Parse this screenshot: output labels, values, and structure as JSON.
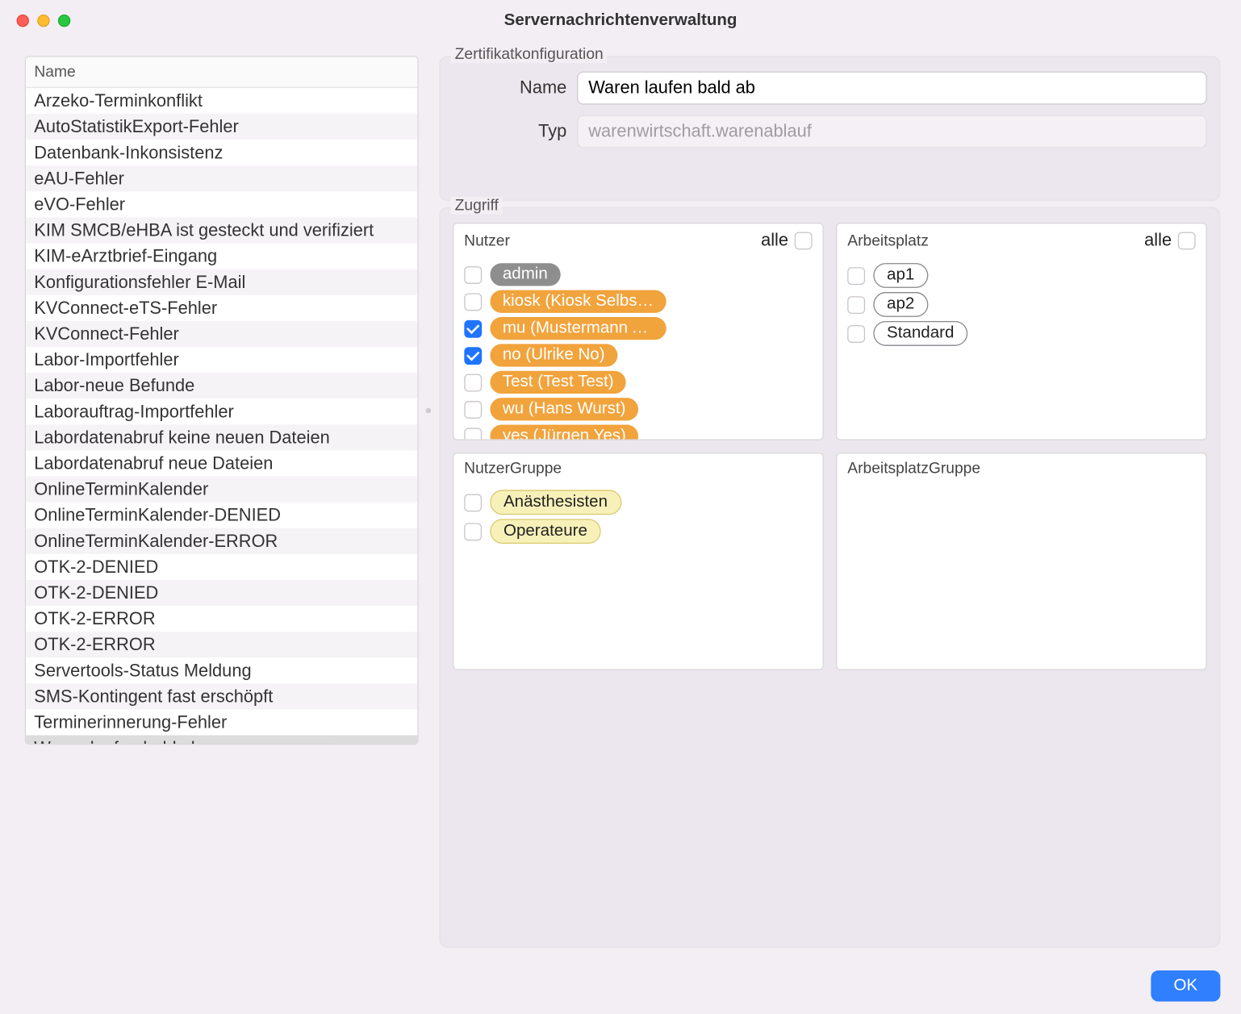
{
  "window": {
    "title": "Servernachrichtenverwaltung"
  },
  "list": {
    "header": "Name",
    "items": [
      "Arzeko-Terminkonflikt",
      "AutoStatistikExport-Fehler",
      "Datenbank-Inkonsistenz",
      "eAU-Fehler",
      "eVO-Fehler",
      "KIM SMCB/eHBA ist gesteckt und verifiziert",
      "KIM-eArztbrief-Eingang",
      "Konfigurationsfehler E-Mail",
      "KVConnect-eTS-Fehler",
      "KVConnect-Fehler",
      "Labor-Importfehler",
      "Labor-neue Befunde",
      "Laborauftrag-Importfehler",
      "Labordatenabruf keine neuen Dateien",
      "Labordatenabruf neue Dateien",
      "OnlineTerminKalender",
      "OnlineTerminKalender-DENIED",
      "OnlineTerminKalender-ERROR",
      "OTK-2-DENIED",
      "OTK-2-DENIED",
      "OTK-2-ERROR",
      "OTK-2-ERROR",
      "Servertools-Status Meldung",
      "SMS-Kontingent fast erschöpft",
      "Terminerinnerung-Fehler",
      "Waren laufen bald ab"
    ],
    "selectedIndex": 25
  },
  "cert": {
    "legend": "Zertifikatkonfiguration",
    "nameLabel": "Name",
    "nameValue": "Waren laufen bald ab",
    "typLabel": "Typ",
    "typValue": "warenwirtschaft.warenablauf"
  },
  "access": {
    "legend": "Zugriff",
    "allLabel": "alle",
    "nutzer": {
      "title": "Nutzer",
      "all": false,
      "items": [
        {
          "label": "admin",
          "style": "user-admin",
          "checked": false
        },
        {
          "label": "kiosk (Kiosk Selbstanme…",
          "style": "user-orange",
          "checked": false
        },
        {
          "label": "mu (Mustermann Angeli…",
          "style": "user-orange",
          "checked": true
        },
        {
          "label": "no (Ulrike No)",
          "style": "user-orange",
          "checked": true
        },
        {
          "label": "Test (Test Test)",
          "style": "user-orange",
          "checked": false
        },
        {
          "label": "wu (Hans Wurst)",
          "style": "user-orange",
          "checked": false
        },
        {
          "label": "yes (Jürgen Yes)",
          "style": "user-orange",
          "checked": false
        }
      ]
    },
    "arbeitsplatz": {
      "title": "Arbeitsplatz",
      "all": false,
      "items": [
        {
          "label": "ap1",
          "style": "ws",
          "checked": false
        },
        {
          "label": "ap2",
          "style": "ws",
          "checked": false
        },
        {
          "label": "Standard",
          "style": "ws",
          "checked": false
        }
      ]
    },
    "nutzerGruppe": {
      "title": "NutzerGruppe",
      "items": [
        {
          "label": "Anästhesisten",
          "style": "group-yellow",
          "checked": false
        },
        {
          "label": "Operateure",
          "style": "group-yellow",
          "checked": false
        }
      ]
    },
    "arbeitsplatzGruppe": {
      "title": "ArbeitsplatzGruppe",
      "items": []
    }
  },
  "footer": {
    "ok": "OK"
  }
}
